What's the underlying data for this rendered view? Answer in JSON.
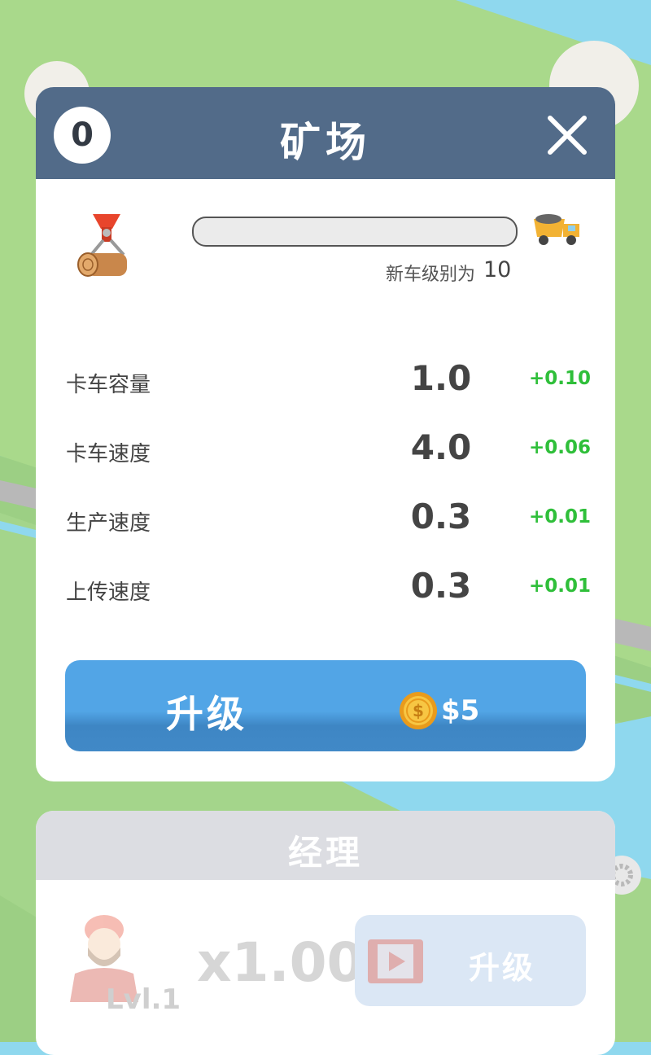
{
  "modal": {
    "level": "0",
    "title": "矿场",
    "progress_fraction": 0.0,
    "next_level_label": "新车级别为",
    "next_level_value": "10",
    "stats": [
      {
        "label": "卡车容量",
        "value": "1.0",
        "delta": "+0.10"
      },
      {
        "label": "卡车速度",
        "value": "4.0",
        "delta": "+0.06"
      },
      {
        "label": "生产速度",
        "value": "0.3",
        "delta": "+0.01"
      },
      {
        "label": "上传速度",
        "value": "0.3",
        "delta": "+0.01"
      }
    ],
    "upgrade_label": "升级",
    "upgrade_price": "$5"
  },
  "manager": {
    "title": "经理",
    "level": "Lvl.1",
    "multiplier": "x1.00",
    "upgrade_label": "升级"
  },
  "icons": {
    "close": "close-icon",
    "producer": "log-grabber-icon",
    "truck": "dump-truck-icon",
    "coin": "coin-icon",
    "video": "video-play-icon",
    "gear": "gear-icon",
    "avatar": "lumberjack-avatar-icon"
  },
  "colors": {
    "header": "#526b89",
    "accent_button": "#52a5e6",
    "delta_green": "#2fbf3a"
  }
}
